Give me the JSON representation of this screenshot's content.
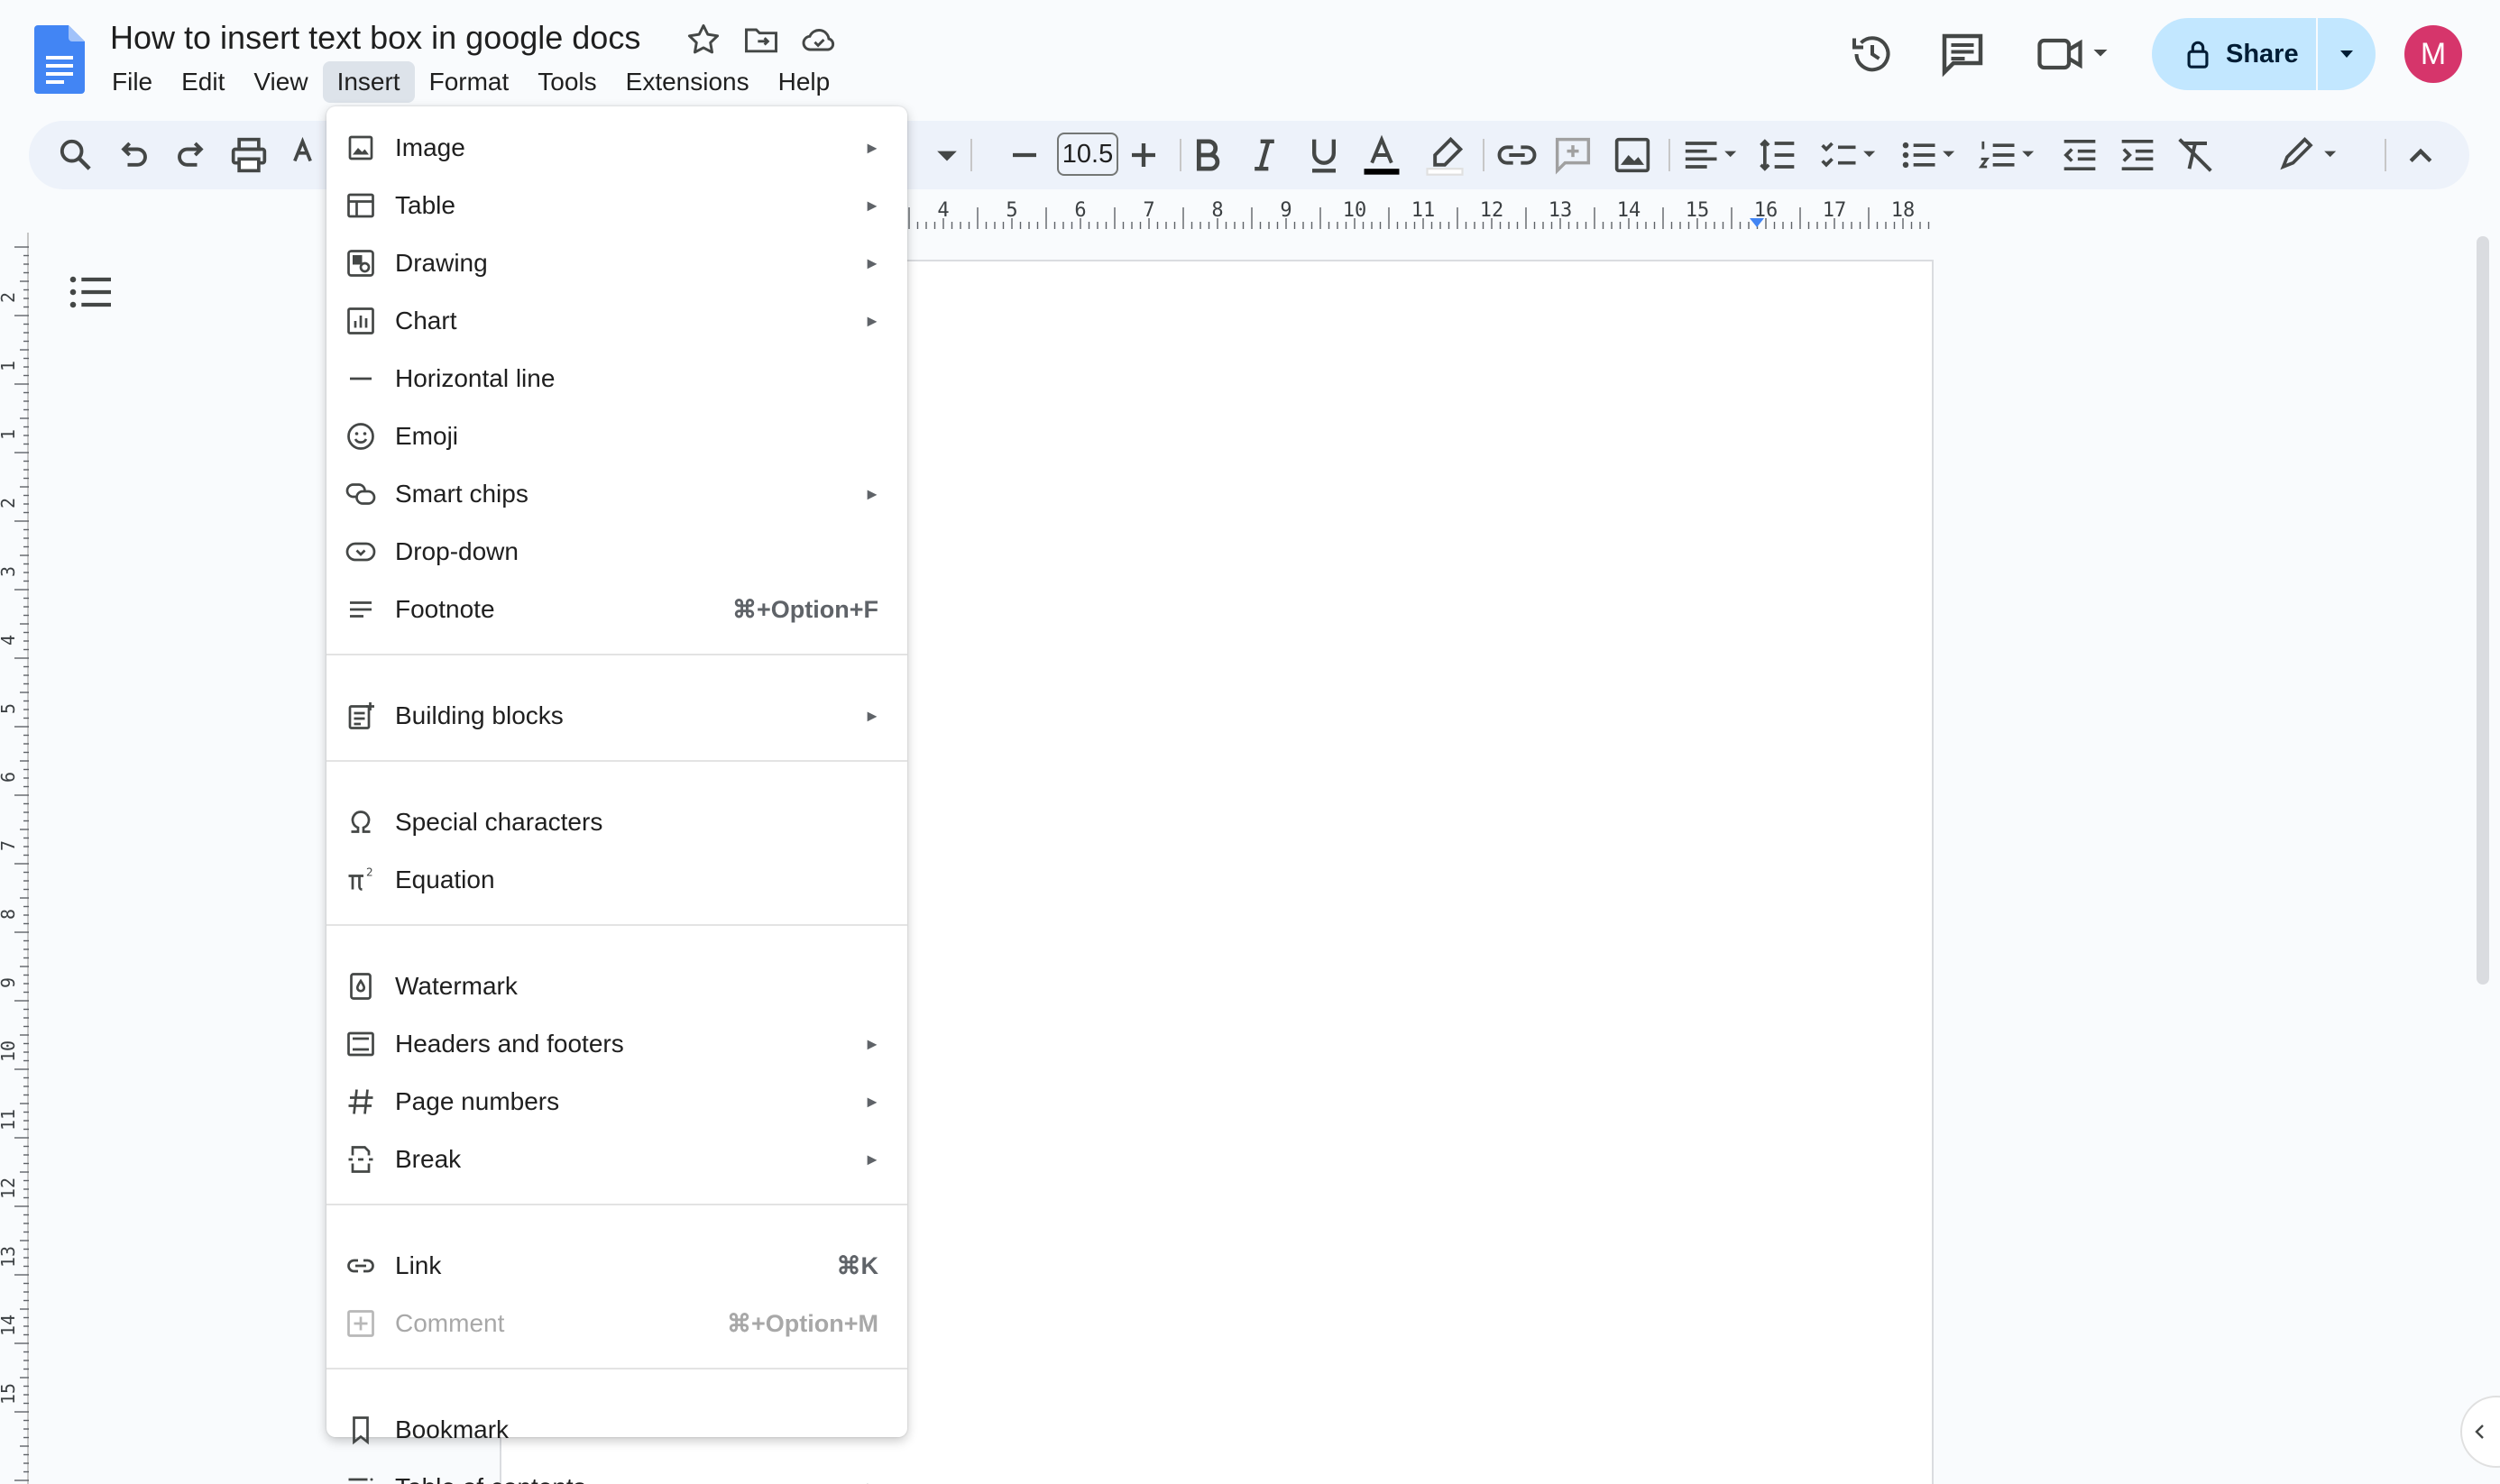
{
  "document": {
    "title": "How to insert text box in google docs"
  },
  "menubar": {
    "items": [
      "File",
      "Edit",
      "View",
      "Insert",
      "Format",
      "Tools",
      "Extensions",
      "Help"
    ],
    "active": "Insert"
  },
  "header": {
    "share_label": "Share",
    "avatar_letter": "M",
    "share_color": "#c2e7ff",
    "avatar_color": "#d6356b"
  },
  "toolbar": {
    "font_size": "10.5"
  },
  "ruler": {
    "top_numbers": [
      "4",
      "5",
      "6",
      "7",
      "8",
      "9",
      "10",
      "11",
      "12",
      "13",
      "14",
      "15",
      "16",
      "17",
      "18"
    ],
    "left_numbers": [
      "2",
      "1",
      "1",
      "2",
      "3",
      "4",
      "5",
      "6",
      "7",
      "8",
      "9",
      "10",
      "11",
      "12",
      "13",
      "14",
      "15"
    ]
  },
  "insert_menu": {
    "groups": [
      [
        {
          "label": "Image",
          "icon": "image-icon",
          "submenu": true
        },
        {
          "label": "Table",
          "icon": "table-icon",
          "submenu": true
        },
        {
          "label": "Drawing",
          "icon": "drawing-icon",
          "submenu": true
        },
        {
          "label": "Chart",
          "icon": "chart-icon",
          "submenu": true
        },
        {
          "label": "Horizontal line",
          "icon": "horizontal-line-icon"
        },
        {
          "label": "Emoji",
          "icon": "emoji-icon"
        },
        {
          "label": "Smart chips",
          "icon": "smart-chips-icon",
          "submenu": true
        },
        {
          "label": "Drop-down",
          "icon": "dropdown-icon"
        },
        {
          "label": "Footnote",
          "icon": "footnote-icon",
          "shortcut": "⌘+Option+F"
        }
      ],
      [
        {
          "label": "Building blocks",
          "icon": "building-blocks-icon",
          "submenu": true
        }
      ],
      [
        {
          "label": "Special characters",
          "icon": "omega-icon"
        },
        {
          "label": "Equation",
          "icon": "equation-icon"
        }
      ],
      [
        {
          "label": "Watermark",
          "icon": "watermark-icon"
        },
        {
          "label": "Headers and footers",
          "icon": "headers-footers-icon",
          "submenu": true
        },
        {
          "label": "Page numbers",
          "icon": "hash-icon",
          "submenu": true
        },
        {
          "label": "Break",
          "icon": "break-icon",
          "submenu": true
        }
      ],
      [
        {
          "label": "Link",
          "icon": "link-icon",
          "shortcut": "⌘K"
        },
        {
          "label": "Comment",
          "icon": "comment-icon",
          "shortcut": "⌘+Option+M",
          "disabled": true
        }
      ],
      [
        {
          "label": "Bookmark",
          "icon": "bookmark-icon"
        },
        {
          "label": "Table of contents",
          "icon": "table-of-contents-icon",
          "submenu": true
        }
      ]
    ]
  }
}
